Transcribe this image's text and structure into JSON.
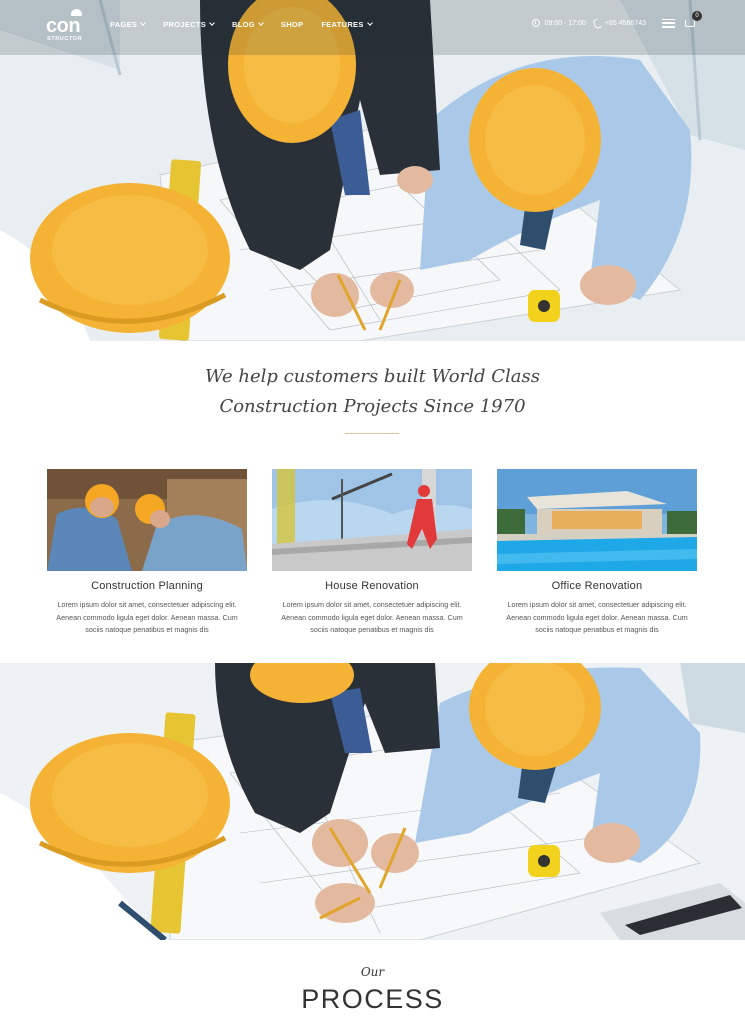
{
  "brand": {
    "logo_main": "con",
    "logo_sub": "STRUCTOR"
  },
  "nav": {
    "items": [
      {
        "label": "PAGES",
        "dropdown": true
      },
      {
        "label": "PROJECTS",
        "dropdown": true
      },
      {
        "label": "BLOG",
        "dropdown": true
      },
      {
        "label": "SHOP",
        "dropdown": false
      },
      {
        "label": "FEATURES",
        "dropdown": true
      }
    ],
    "hours": "09:00 - 17:00",
    "phone": "+65 4566743",
    "cart_count": "0"
  },
  "headline": {
    "line1": "We help customers built World Class",
    "line2": "Construction Projects Since 1970"
  },
  "services": [
    {
      "title": "Construction Planning",
      "text": "Lorem ipsum dolor sit amet, consectetuer adipiscing elit. Aenean commodo ligula eget dolor. Aenean massa. Cum sociis natoque penatibus et magnis dis"
    },
    {
      "title": "House Renovation",
      "text": "Lorem ipsum dolor sit amet, consectetuer adipiscing elit. Aenean commodo ligula eget dolor. Aenean massa. Cum sociis natoque penatibus et magnis dis"
    },
    {
      "title": "Office Renovation",
      "text": "Lorem ipsum dolor sit amet, consectetuer adipiscing elit. Aenean commodo ligula eget dolor. Aenean massa. Cum sociis natoque penatibus et magnis dis"
    }
  ],
  "process": {
    "eyebrow": "Our",
    "title": "PROCESS"
  },
  "colors": {
    "helmet": "#f5b335",
    "accent_rule": "#d8c9a0",
    "text": "#333333"
  }
}
